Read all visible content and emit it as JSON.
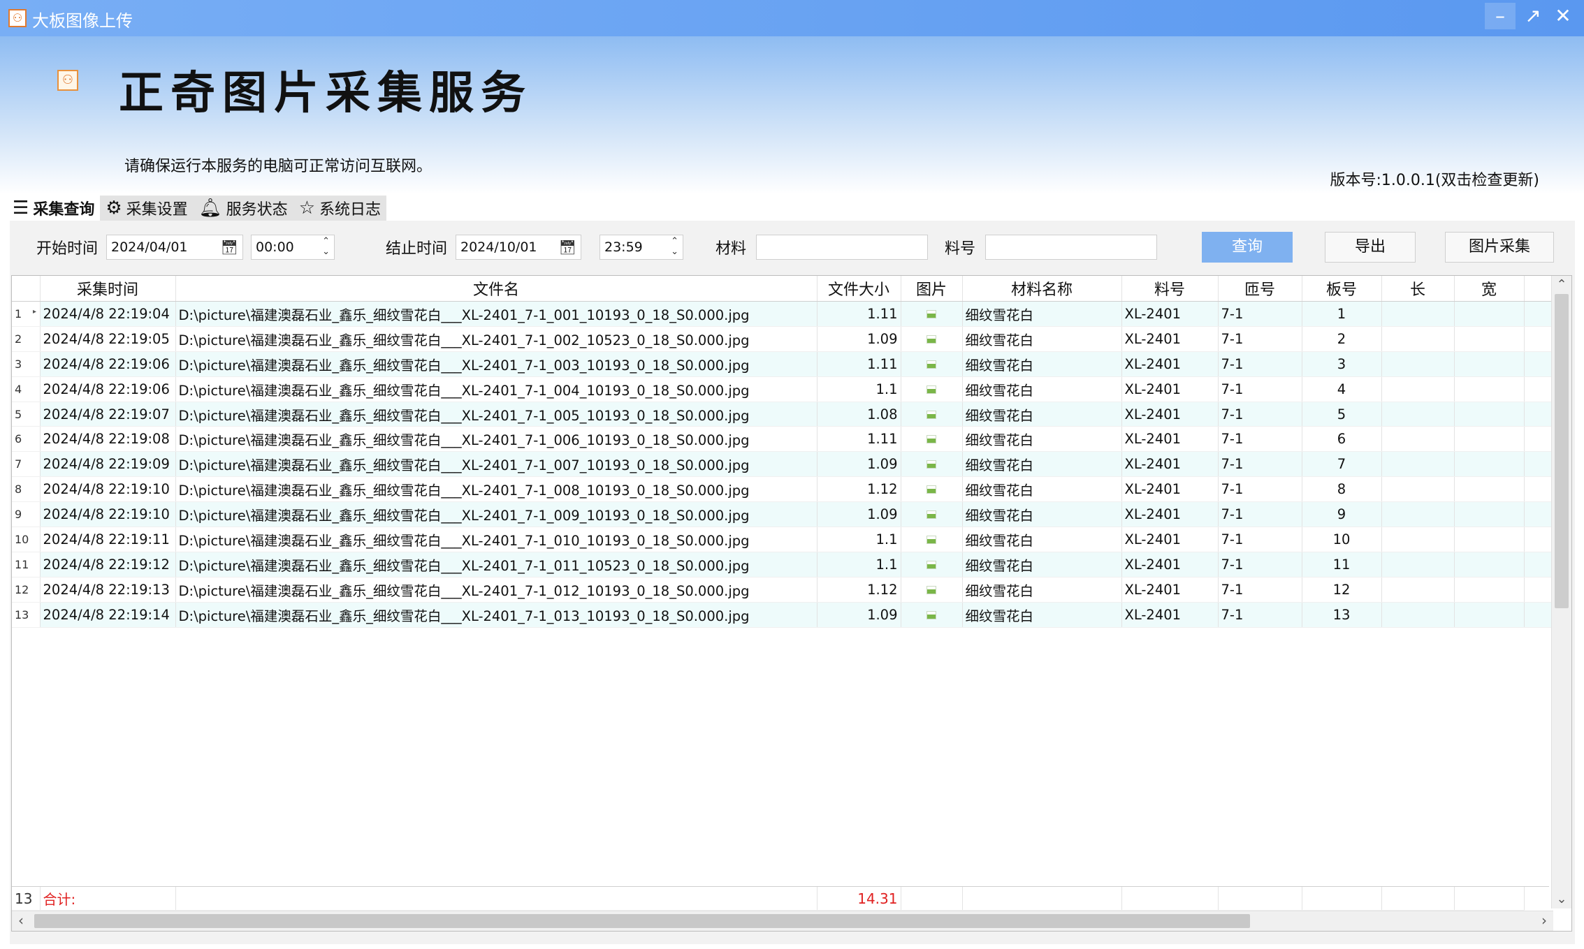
{
  "window": {
    "title": "大板图像上传"
  },
  "header": {
    "app_name": "正奇图片采集服务",
    "notice": "请确保运行本服务的电脑可正常访问互联网。",
    "version": "版本号:1.0.0.1(双击检查更新)"
  },
  "tabs": [
    {
      "label": "采集查询",
      "icon": "menu-icon",
      "active": true
    },
    {
      "label": "采集设置",
      "icon": "gears-icon"
    },
    {
      "label": "服务状态",
      "icon": "bell-icon"
    },
    {
      "label": "系统日志",
      "icon": "star-icon"
    }
  ],
  "filter": {
    "start_label": "开始时间",
    "start_date": "2024/04/01",
    "start_time": "00:00",
    "end_label": "结止时间",
    "end_date": "2024/10/01",
    "end_time": "23:59",
    "material_label": "材料",
    "material_value": "",
    "part_label": "料号",
    "part_value": "",
    "query_btn": "查询",
    "export_btn": "导出",
    "capture_btn": "图片采集"
  },
  "table": {
    "columns": [
      "采集时间",
      "文件名",
      "文件大小",
      "图片",
      "材料名称",
      "料号",
      "匝号",
      "板号",
      "长",
      "宽"
    ],
    "rows": [
      [
        "1",
        "2024/4/8 22:19:04",
        "D:\\picture\\福建澳磊石业_鑫乐_细纹雪花白___XL-2401_7-1_001_10193_0_18_S0.000.jpg",
        "1.11",
        "细纹雪花白",
        "XL-2401",
        "7-1",
        "1"
      ],
      [
        "2",
        "2024/4/8 22:19:05",
        "D:\\picture\\福建澳磊石业_鑫乐_细纹雪花白___XL-2401_7-1_002_10523_0_18_S0.000.jpg",
        "1.09",
        "细纹雪花白",
        "XL-2401",
        "7-1",
        "2"
      ],
      [
        "3",
        "2024/4/8 22:19:06",
        "D:\\picture\\福建澳磊石业_鑫乐_细纹雪花白___XL-2401_7-1_003_10193_0_18_S0.000.jpg",
        "1.11",
        "细纹雪花白",
        "XL-2401",
        "7-1",
        "3"
      ],
      [
        "4",
        "2024/4/8 22:19:06",
        "D:\\picture\\福建澳磊石业_鑫乐_细纹雪花白___XL-2401_7-1_004_10193_0_18_S0.000.jpg",
        "1.1",
        "细纹雪花白",
        "XL-2401",
        "7-1",
        "4"
      ],
      [
        "5",
        "2024/4/8 22:19:07",
        "D:\\picture\\福建澳磊石业_鑫乐_细纹雪花白___XL-2401_7-1_005_10193_0_18_S0.000.jpg",
        "1.08",
        "细纹雪花白",
        "XL-2401",
        "7-1",
        "5"
      ],
      [
        "6",
        "2024/4/8 22:19:08",
        "D:\\picture\\福建澳磊石业_鑫乐_细纹雪花白___XL-2401_7-1_006_10193_0_18_S0.000.jpg",
        "1.11",
        "细纹雪花白",
        "XL-2401",
        "7-1",
        "6"
      ],
      [
        "7",
        "2024/4/8 22:19:09",
        "D:\\picture\\福建澳磊石业_鑫乐_细纹雪花白___XL-2401_7-1_007_10193_0_18_S0.000.jpg",
        "1.09",
        "细纹雪花白",
        "XL-2401",
        "7-1",
        "7"
      ],
      [
        "8",
        "2024/4/8 22:19:10",
        "D:\\picture\\福建澳磊石业_鑫乐_细纹雪花白___XL-2401_7-1_008_10193_0_18_S0.000.jpg",
        "1.12",
        "细纹雪花白",
        "XL-2401",
        "7-1",
        "8"
      ],
      [
        "9",
        "2024/4/8 22:19:10",
        "D:\\picture\\福建澳磊石业_鑫乐_细纹雪花白___XL-2401_7-1_009_10193_0_18_S0.000.jpg",
        "1.09",
        "细纹雪花白",
        "XL-2401",
        "7-1",
        "9"
      ],
      [
        "10",
        "2024/4/8 22:19:11",
        "D:\\picture\\福建澳磊石业_鑫乐_细纹雪花白___XL-2401_7-1_010_10193_0_18_S0.000.jpg",
        "1.1",
        "细纹雪花白",
        "XL-2401",
        "7-1",
        "10"
      ],
      [
        "11",
        "2024/4/8 22:19:12",
        "D:\\picture\\福建澳磊石业_鑫乐_细纹雪花白___XL-2401_7-1_011_10523_0_18_S0.000.jpg",
        "1.1",
        "细纹雪花白",
        "XL-2401",
        "7-1",
        "11"
      ],
      [
        "12",
        "2024/4/8 22:19:13",
        "D:\\picture\\福建澳磊石业_鑫乐_细纹雪花白___XL-2401_7-1_012_10193_0_18_S0.000.jpg",
        "1.12",
        "细纹雪花白",
        "XL-2401",
        "7-1",
        "12"
      ],
      [
        "13",
        "2024/4/8 22:19:14",
        "D:\\picture\\福建澳磊石业_鑫乐_细纹雪花白___XL-2401_7-1_013_10193_0_18_S0.000.jpg",
        "1.09",
        "细纹雪花白",
        "XL-2401",
        "7-1",
        "13"
      ]
    ],
    "footer": {
      "count": "13",
      "label": "合计:",
      "total_size": "14.31"
    }
  },
  "colors": {
    "titlebar": "#6aa3f3",
    "primary_button": "#7fb1f0",
    "odd_row": "#eefbfb",
    "total_text": "#e02020"
  }
}
